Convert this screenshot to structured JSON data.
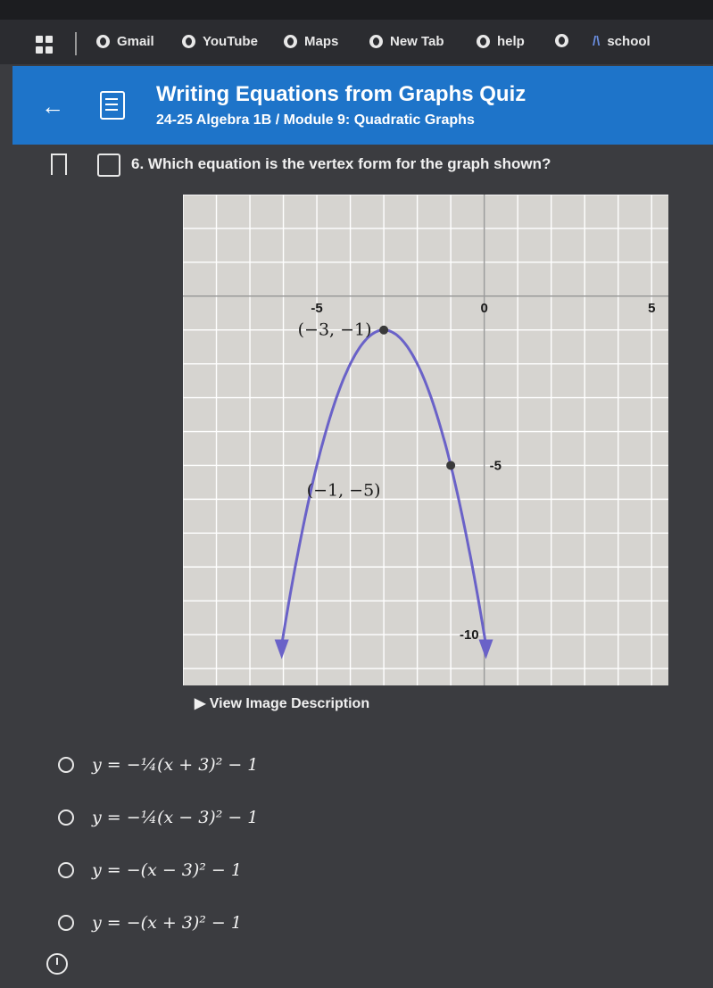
{
  "bookmarks": [
    "Gmail",
    "YouTube",
    "Maps",
    "New Tab",
    "help",
    "",
    "school"
  ],
  "header": {
    "title": "Writing Equations from Graphs Quiz",
    "subtitle": "24-25 Algebra 1B / Module 9: Quadratic Graphs"
  },
  "question": "6. Which equation is the vertex form for the graph shown?",
  "chart_data": {
    "type": "line",
    "x_tick_labels": [
      "-5",
      "0",
      "5"
    ],
    "y_tick_labels": [
      "-5",
      "-10"
    ],
    "points": [
      {
        "label": "(−3, −1)",
        "x": -3,
        "y": -1
      },
      {
        "label": "(−1, −5)",
        "x": -1,
        "y": -5
      }
    ],
    "curve": {
      "a": -1,
      "h": -3,
      "k": -1
    },
    "xlim": [
      -9,
      5.5
    ],
    "ylim": [
      -11.5,
      3
    ],
    "grid": true
  },
  "view_description": "View Image Description",
  "options": [
    "y = −¼(x + 3)² − 1",
    "y = −¼(x − 3)² − 1",
    "y = −(x − 3)² − 1",
    "y = −(x + 3)² − 1"
  ],
  "colors": {
    "header": "#1e74c9",
    "curve": "#6a62c8",
    "background": "#3b3c40"
  }
}
